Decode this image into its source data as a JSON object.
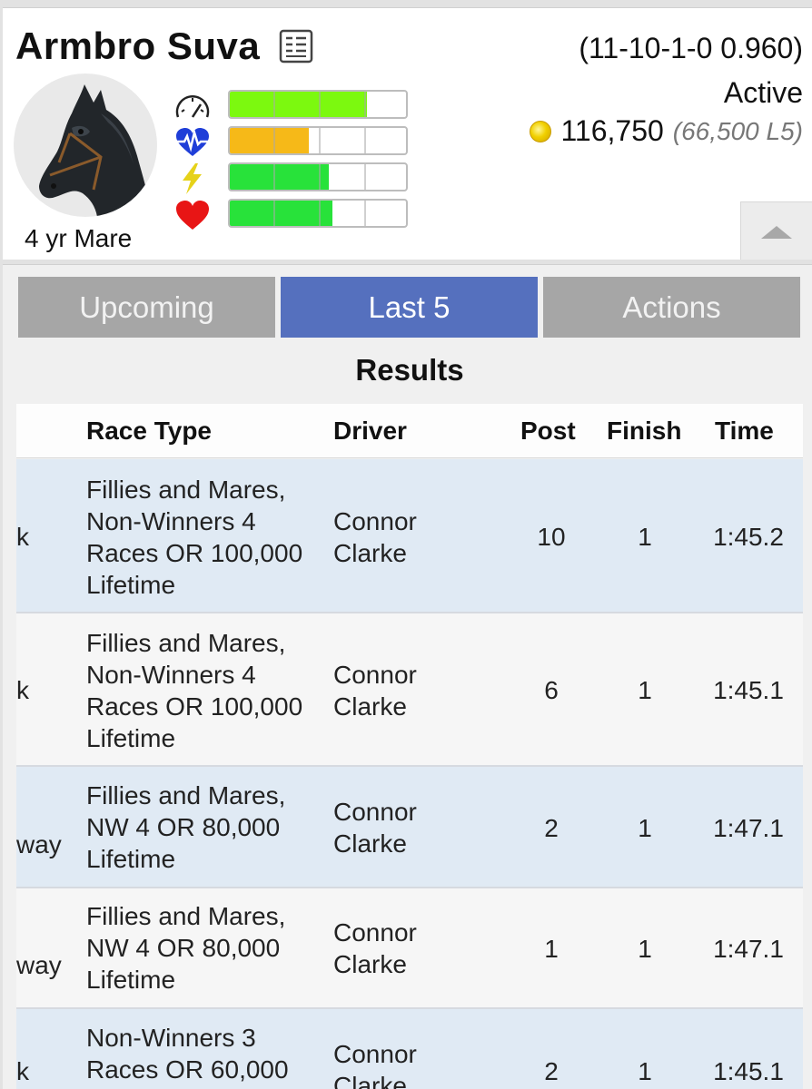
{
  "horse": {
    "name": "Armbro Suva",
    "age_sex": "4 yr Mare",
    "record": "(11-10-1-0 0.960)",
    "status": "Active",
    "earnings": "116,750",
    "earnings_l5": "(66,500 L5)"
  },
  "stats": [
    {
      "icon": "speedometer-icon",
      "fill_fraction": 0.78,
      "color": "#7cf90f"
    },
    {
      "icon": "heartbeat-icon",
      "fill_fraction": 0.45,
      "color": "#f6b918"
    },
    {
      "icon": "lightning-icon",
      "fill_fraction": 0.56,
      "color": "#28e23a"
    },
    {
      "icon": "heart-icon",
      "fill_fraction": 0.58,
      "color": "#28e23a"
    }
  ],
  "tabs": [
    {
      "label": "Upcoming",
      "active": false
    },
    {
      "label": "Last 5",
      "active": true
    },
    {
      "label": "Actions",
      "active": false
    }
  ],
  "results": {
    "title": "Results",
    "columns": {
      "race_type": "Race Type",
      "driver": "Driver",
      "post": "Post",
      "finish": "Finish",
      "time": "Time"
    },
    "rows": [
      {
        "track": "k",
        "race_type": "Fillies and Mares, Non-Winners 4 Races OR 100,000 Lifetime",
        "driver": "Connor Clarke",
        "post": "10",
        "finish": "1",
        "time": "1:45.2"
      },
      {
        "track": "k",
        "race_type": "Fillies and Mares, Non-Winners 4 Races OR 100,000 Lifetime",
        "driver": "Connor Clarke",
        "post": "6",
        "finish": "1",
        "time": "1:45.1"
      },
      {
        "track": "way",
        "race_type": "Fillies and Mares, NW 4 OR 80,000 Lifetime",
        "driver": "Connor Clarke",
        "post": "2",
        "finish": "1",
        "time": "1:47.1"
      },
      {
        "track": "way",
        "race_type": "Fillies and Mares, NW 4 OR 80,000 Lifetime",
        "driver": "Connor Clarke",
        "post": "1",
        "finish": "1",
        "time": "1:47.1"
      },
      {
        "track": "k",
        "race_type": "Non-Winners 3 Races OR 60,000",
        "driver": "Connor Clarke",
        "post": "2",
        "finish": "1",
        "time": "1:45.1"
      }
    ]
  }
}
